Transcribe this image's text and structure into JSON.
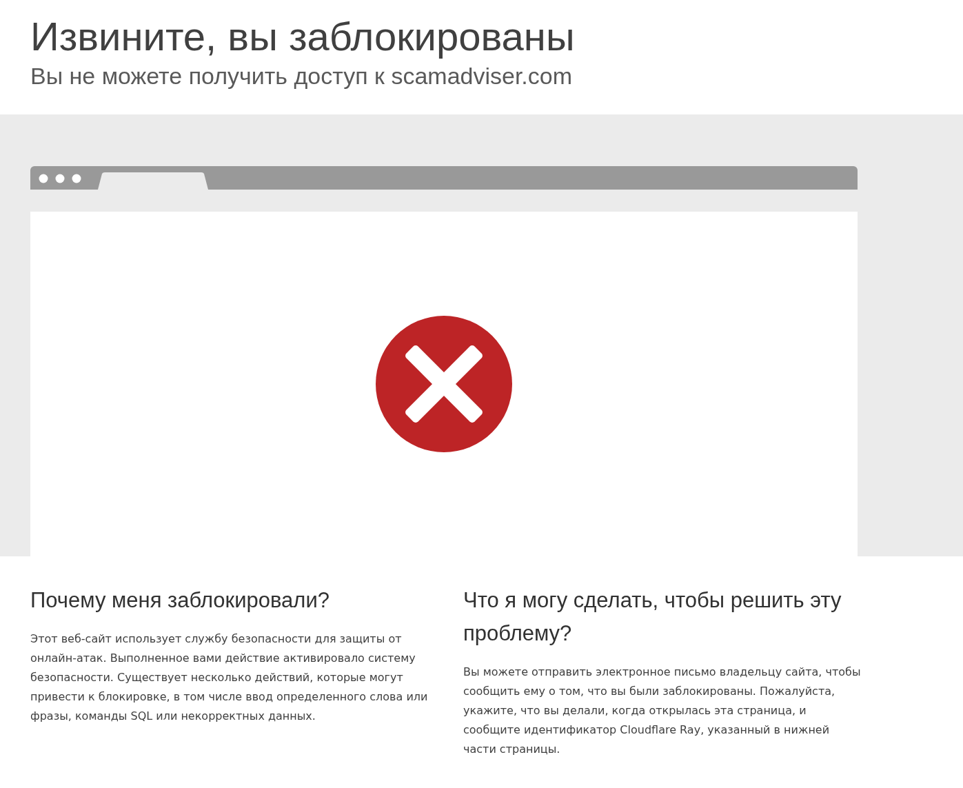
{
  "header": {
    "title": "Извините, вы заблокированы",
    "subtitle": "Вы не можете получить доступ к scamadviser.com"
  },
  "sections": [
    {
      "heading": "Почему меня заблокировали?",
      "text": "Этот веб-сайт использует службу безопасности для защиты от онлайн-атак. Выполненное вами действие активировало систему безопасности. Существует несколько действий, которые могут привести к блокировке, в том числе ввод определенного слова или фразы, команды SQL или некорректных данных."
    },
    {
      "heading": "Что я могу сделать, чтобы решить эту проблему?",
      "text": "Вы можете отправить электронное письмо владельцу сайта, чтобы сообщить ему о том, что вы были заблокированы. Пожалуйста, укажите, что вы делали, когда открылась эта страница, и сообщите идентификатор Cloudflare Ray, указанный в нижней части страницы."
    }
  ]
}
